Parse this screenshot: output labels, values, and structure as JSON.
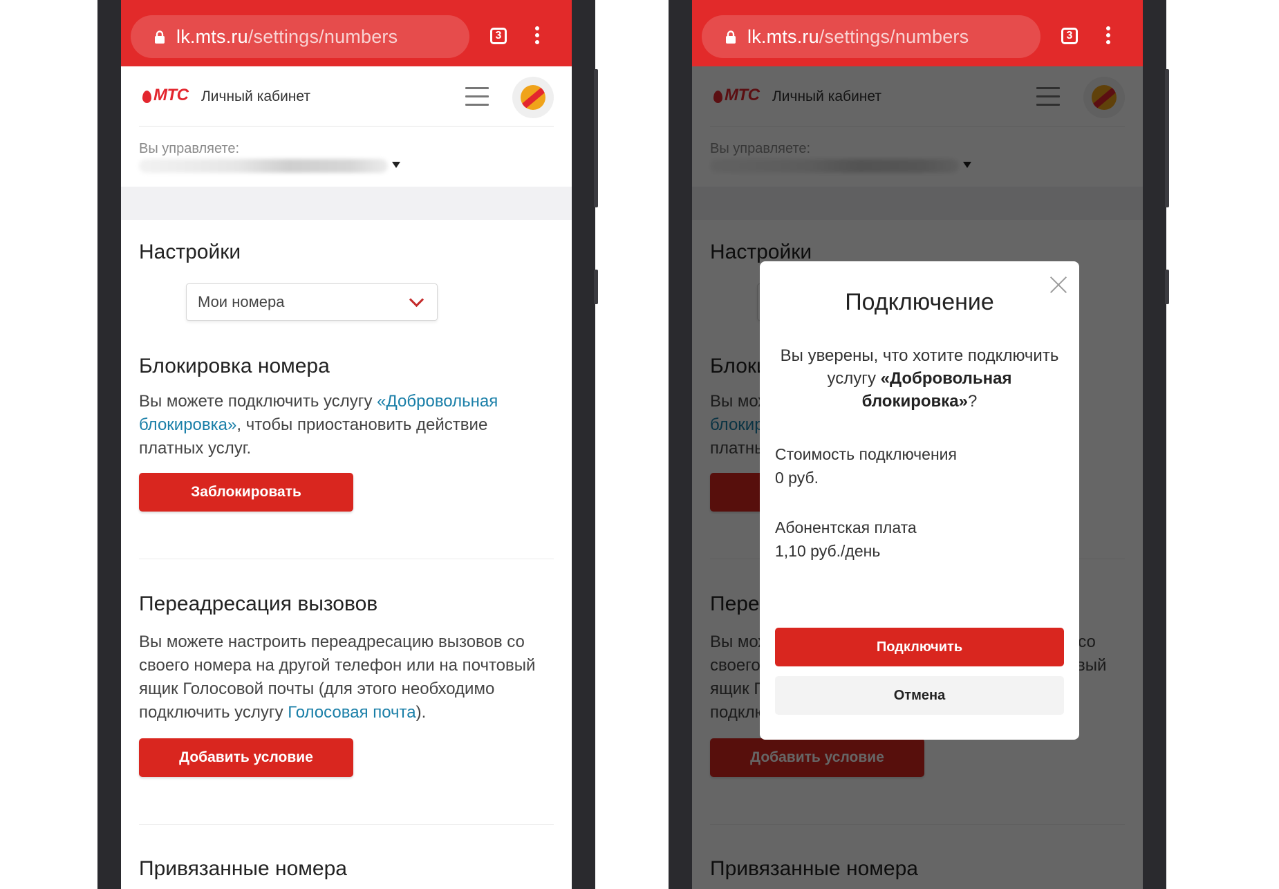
{
  "browser": {
    "url_host": "lk.mts.ru",
    "url_path": "/settings/numbers",
    "tab_count": "3"
  },
  "header": {
    "logo_text": "МТС",
    "cabinet_label": "Личный кабинет"
  },
  "account": {
    "manage_label": "Вы управляете:"
  },
  "settings": {
    "title": "Настройки",
    "select_value": "Мои номера"
  },
  "block_section": {
    "title": "Блокировка номера",
    "text_before": "Вы можете подключить услугу ",
    "link": "«Добровольная блокировка»",
    "text_after": ", чтобы приостановить действие платных услуг.",
    "button": "Заблокировать"
  },
  "forward_section": {
    "title": "Переадресация вызовов",
    "text_before": "Вы можете настроить переадресацию вызовов со своего номера на другой телефон или на почтовый ящик Голосовой почты (для этого необходимо подключить услугу ",
    "link": "Голосовая почта",
    "text_after": ").",
    "button": "Добавить условие"
  },
  "linked_section": {
    "title": "Привязанные номера"
  },
  "modal": {
    "title": "Подключение",
    "question_before": "Вы уверены, что хотите подключить услугу ",
    "question_service": "«Добровольная блокировка»",
    "question_after": "?",
    "connect_cost_label": "Стоимость подключения",
    "connect_cost_value": "0 руб.",
    "fee_label": "Абонентская плата",
    "fee_value": "1,10 руб./день",
    "confirm_button": "Подключить",
    "cancel_button": "Отмена"
  },
  "colors": {
    "brand_red": "#e22a2a",
    "button_red": "#d9261f",
    "link_blue": "#1a7fa8"
  }
}
